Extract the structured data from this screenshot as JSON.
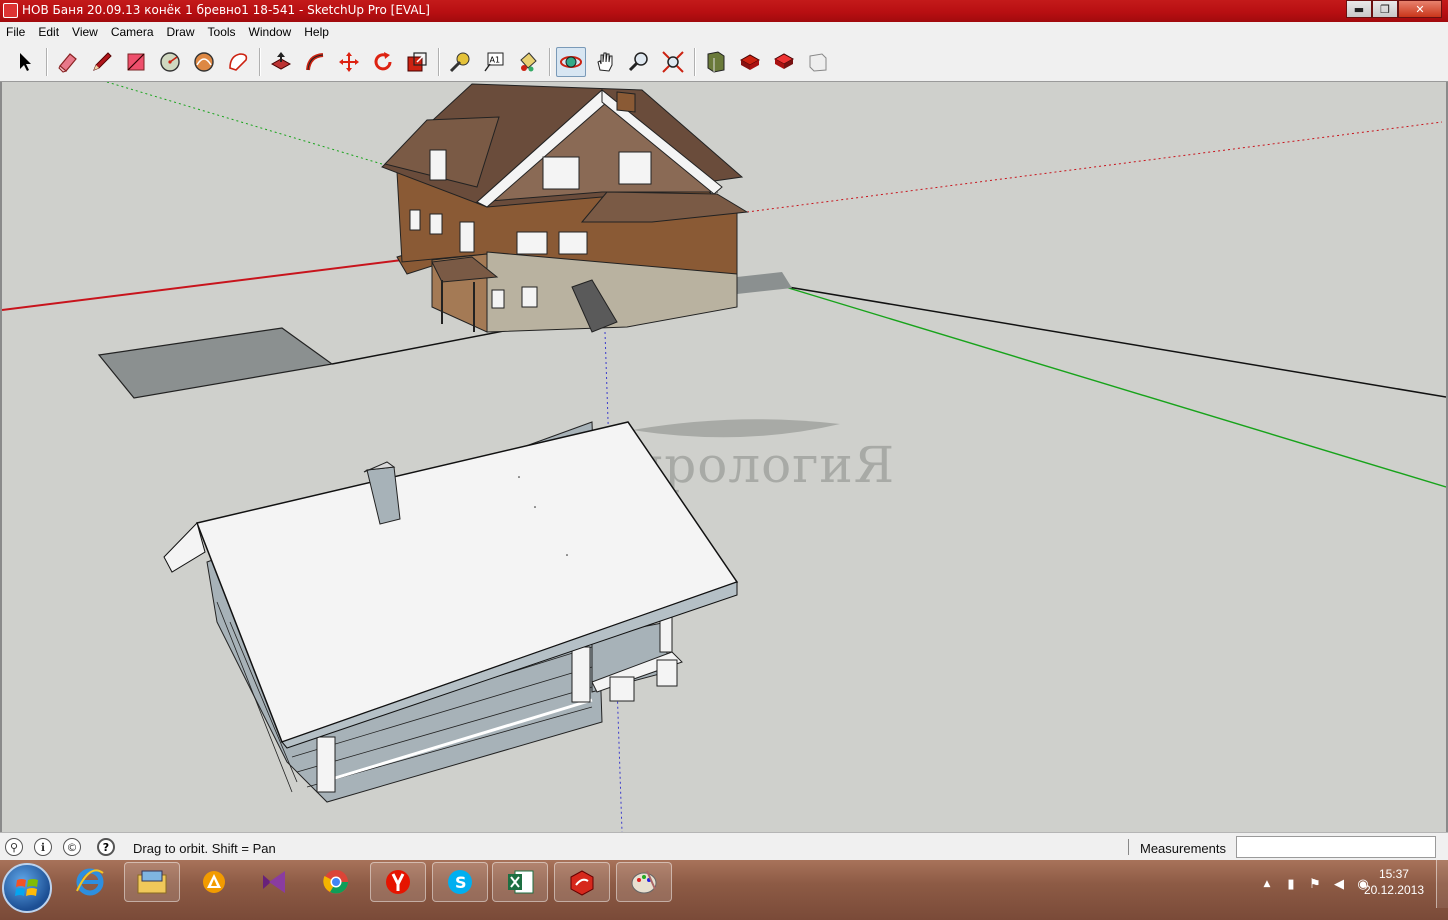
{
  "window": {
    "title": "НОВ Баня 20.09.13 конёк 1 бревно1 18-541 - SketchUp Pro [EVAL]",
    "minimize_glyph": "▬",
    "maximize_glyph": "❐",
    "close_glyph": "✕"
  },
  "menu": {
    "items": [
      "File",
      "Edit",
      "View",
      "Camera",
      "Draw",
      "Tools",
      "Window",
      "Help"
    ]
  },
  "toolbar": {
    "tools": [
      {
        "name": "select-icon",
        "group": 1
      },
      {
        "name": "eraser-icon",
        "group": 2
      },
      {
        "name": "pencil-icon",
        "group": 2
      },
      {
        "name": "rectangle-icon",
        "group": 2
      },
      {
        "name": "circle-icon",
        "group": 2
      },
      {
        "name": "arc-icon",
        "group": 2
      },
      {
        "name": "polygon-icon",
        "group": 2
      },
      {
        "name": "push-pull-icon",
        "group": 3
      },
      {
        "name": "follow-me-icon",
        "group": 3
      },
      {
        "name": "move-icon",
        "group": 3
      },
      {
        "name": "rotate-icon",
        "group": 3
      },
      {
        "name": "scale-icon",
        "group": 3
      },
      {
        "name": "tape-measure-icon",
        "group": 4
      },
      {
        "name": "text-icon",
        "group": 4
      },
      {
        "name": "paint-bucket-icon",
        "group": 4
      },
      {
        "name": "orbit-icon",
        "group": 5,
        "active": true
      },
      {
        "name": "pan-icon",
        "group": 5
      },
      {
        "name": "zoom-icon",
        "group": 5
      },
      {
        "name": "zoom-extents-icon",
        "group": 5
      },
      {
        "name": "3d-warehouse-icon",
        "group": 6
      },
      {
        "name": "share-model-icon",
        "group": 6
      },
      {
        "name": "get-components-icon",
        "group": 6
      },
      {
        "name": "extension-icon",
        "group": 6
      }
    ],
    "text_tool_label": "A1"
  },
  "viewport": {
    "watermark": "ГидрологиЯ",
    "colors": {
      "background": "#cfd0cc",
      "axis_red": "#c8141c",
      "axis_green": "#17a31a",
      "roof_brown": "#7a5a45",
      "wall_brown": "#8a5a35",
      "stone": "#b9b2a0",
      "roof_white": "#f4f4f4",
      "log_grey": "#a7b2b8",
      "shadow": "#8b9090"
    }
  },
  "status": {
    "help_text": "Drag to orbit.  Shift = Pan",
    "measurements_label": "Measurements",
    "measurements_value": "",
    "icons": [
      "geo-location-icon",
      "credits-icon",
      "copyright-icon",
      "help-icon"
    ],
    "help_glyph": "?"
  },
  "taskbar": {
    "apps": [
      {
        "name": "internet-explorer-icon",
        "pinned": false
      },
      {
        "name": "file-explorer-icon",
        "pinned": true
      },
      {
        "name": "avast-icon",
        "pinned": false
      },
      {
        "name": "visual-studio-icon",
        "pinned": false
      },
      {
        "name": "chrome-icon",
        "pinned": false
      },
      {
        "name": "yandex-browser-icon",
        "pinned": true
      },
      {
        "name": "skype-icon",
        "pinned": true
      },
      {
        "name": "excel-icon",
        "pinned": true
      },
      {
        "name": "sketchup-icon",
        "pinned": true
      },
      {
        "name": "paint-icon",
        "pinned": true
      }
    ],
    "clock_time": "15:37",
    "clock_date": "20.12.2013",
    "tray_icons": [
      "show-hidden-icon",
      "usb-icon",
      "action-center-icon",
      "volume-icon",
      "network-icon"
    ],
    "tray_arrow_glyph": "▲"
  }
}
